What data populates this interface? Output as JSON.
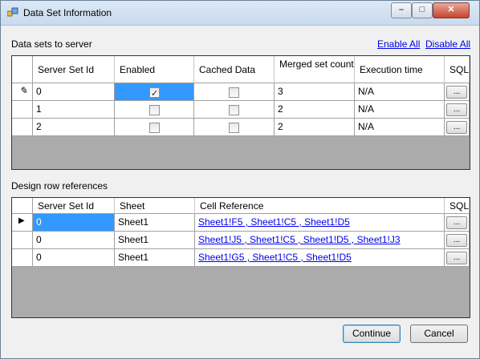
{
  "window": {
    "title": "Data Set Information"
  },
  "section1": {
    "label": "Data sets to server",
    "enable_all": "Enable All",
    "disable_all": "Disable All",
    "columns": [
      "Server Set Id",
      "Enabled",
      "Cached Data",
      "Merged set count",
      "Execution time",
      "SQL"
    ],
    "rows": [
      {
        "id": "0",
        "enabled": true,
        "cached": false,
        "merged": "3",
        "exec": "N/A",
        "sql": "..."
      },
      {
        "id": "1",
        "enabled": false,
        "cached": false,
        "merged": "2",
        "exec": "N/A",
        "sql": "..."
      },
      {
        "id": "2",
        "enabled": false,
        "cached": false,
        "merged": "2",
        "exec": "N/A",
        "sql": "..."
      }
    ]
  },
  "section2": {
    "label": "Design row references",
    "columns": [
      "Server Set Id",
      "Sheet",
      "Cell Reference",
      "SQL"
    ],
    "rows": [
      {
        "id": "0",
        "sheet": "Sheet1",
        "ref": "Sheet1!F5 , Sheet1!C5 , Sheet1!D5",
        "sql": "..."
      },
      {
        "id": "0",
        "sheet": "Sheet1",
        "ref": "Sheet1!J5 , Sheet1!C5 , Sheet1!D5 , Sheet1!J3",
        "sql": "..."
      },
      {
        "id": "0",
        "sheet": "Sheet1",
        "ref": "Sheet1!G5 , Sheet1!C5 , Sheet1!D5",
        "sql": "..."
      }
    ]
  },
  "buttons": {
    "continue": "Continue",
    "cancel": "Cancel"
  },
  "colors": {
    "selection": "#3399ff",
    "link": "#0000ee",
    "grid_background": "#ababab"
  }
}
